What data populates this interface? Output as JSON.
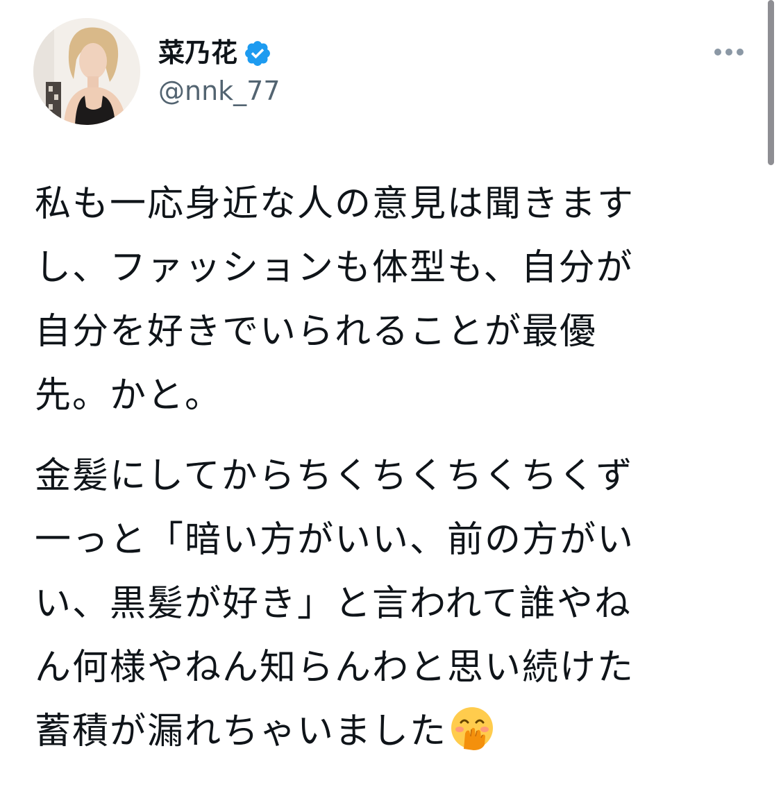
{
  "author": {
    "display_name": "菜乃花",
    "handle": "@nnk_77",
    "verified": true
  },
  "tweet": {
    "paragraph1": [
      "私も一応身近な人の意見は聞きます",
      "し、ファッションも体型も、自分が",
      "自分を好きでいられることが最優",
      "先。かと。"
    ],
    "paragraph2": [
      "金髪にしてからちくちくちくちくず",
      "一っと「暗い方がいい、前の方がい",
      "い、黒髪が好き」と言われて誰やね",
      "ん何様やねん知らんわと思い続けた",
      "蓄積が漏れちゃいました"
    ],
    "trailing_emoji": "face-with-hand-over-mouth-emoji"
  },
  "icons": {
    "verified_badge": "verified-badge-icon",
    "more_menu": "more-dots-icon"
  },
  "colors": {
    "text_primary": "#0f1419",
    "text_secondary": "#536471",
    "verified_blue": "#1d9bf0",
    "dots_gray": "#8b98a5"
  }
}
